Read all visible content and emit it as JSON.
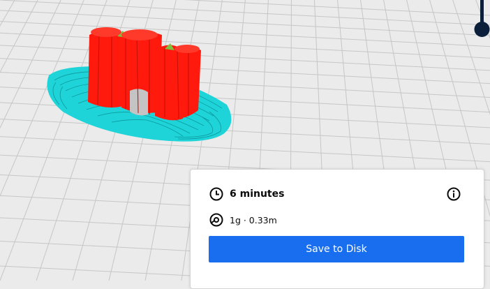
{
  "print_info": {
    "time_label": "6 minutes",
    "material_label": "1g · 0.33m",
    "save_button_label": "Save to Disk"
  },
  "icons": {
    "time": "clock-icon",
    "material": "spool-icon",
    "info": "info-icon"
  },
  "colors": {
    "accent": "#196ef0",
    "model_wall": "#ff1a0d",
    "model_skirt": "#1ed4d8",
    "model_top": "#7fbf3f",
    "viewport_background": "#ebebeb",
    "grid_line": "#c4c4c4",
    "slider": "#0b1e3a"
  }
}
